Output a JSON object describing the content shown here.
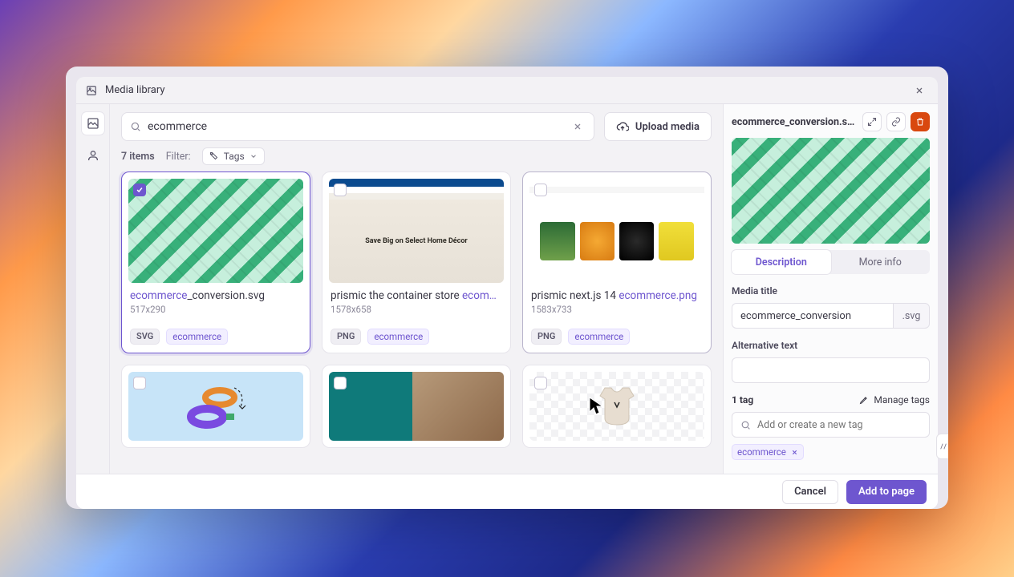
{
  "window": {
    "title": "Media library"
  },
  "search": {
    "value": "ecommerce"
  },
  "upload_label": "Upload media",
  "subbar": {
    "items_label": "7 items",
    "filter_label": "Filter:",
    "tags_chip": "Tags"
  },
  "items": [
    {
      "prefix": "ecommerce",
      "suffix": "_conversion.svg",
      "dims": "517x290",
      "badge": "SVG",
      "tag": "ecommerce",
      "selected": true
    },
    {
      "prefix": "prismic the container store ",
      "hl": "ecom…",
      "dims": "1578x658",
      "badge": "PNG",
      "tag": "ecommerce"
    },
    {
      "prefix": "prismic next.js 14 ",
      "hl": "ecommerce.png",
      "dims": "1583x733",
      "badge": "PNG",
      "tag": "ecommerce",
      "hovered": true
    }
  ],
  "details": {
    "filename": "ecommerce_conversion.svg",
    "tabs": {
      "active": "Description",
      "other": "More info"
    },
    "media_title_lbl": "Media title",
    "media_title_val": "ecommerce_conversion",
    "media_title_ext": ".svg",
    "alt_lbl": "Alternative text",
    "alt_val": "",
    "tag_count": "1 tag",
    "manage_tags": "Manage tags",
    "add_tag_placeholder": "Add or create a new tag",
    "tags": [
      "ecommerce"
    ]
  },
  "footer": {
    "cancel": "Cancel",
    "add": "Add to page"
  },
  "hero_text": "Save Big on Select Home Décor"
}
